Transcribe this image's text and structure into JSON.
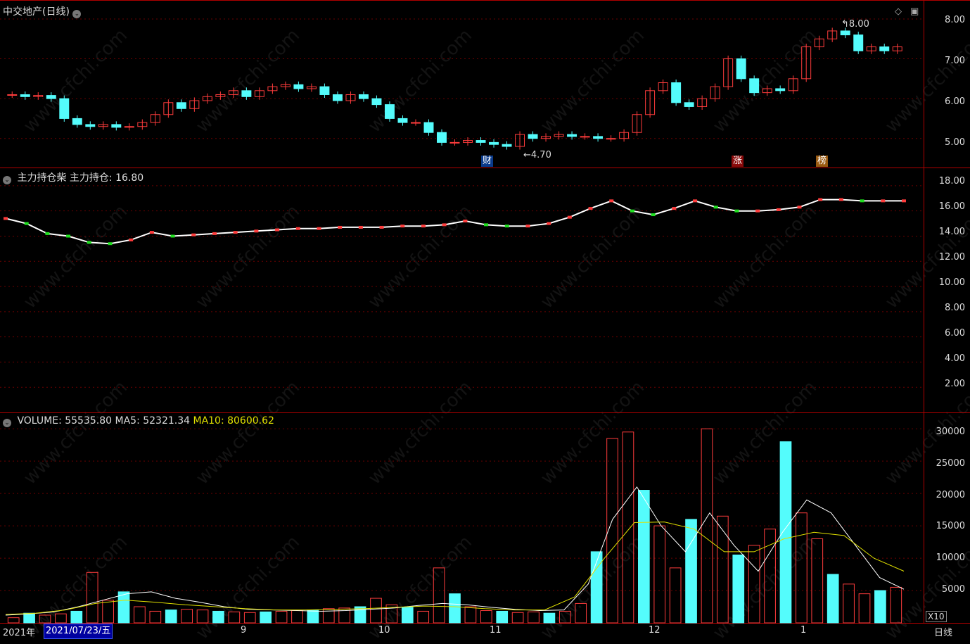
{
  "header": {
    "stock_title": "中交地产(日线)",
    "ma_label": "主力持仓柴",
    "ma_value_label": "主力持仓: 16.80",
    "volume_label": "VOLUME: 55535.80",
    "ma5_label": "MA5: 52321.34",
    "ma10_label": "MA10: 80600.62"
  },
  "price_axis": [
    "8.00",
    "7.00",
    "6.00",
    "5.00"
  ],
  "indicator_axis": [
    "18.00",
    "16.00",
    "14.00",
    "12.00",
    "10.00",
    "8.00",
    "6.00",
    "4.00",
    "2.00"
  ],
  "volume_axis": [
    "30000",
    "25000",
    "20000",
    "15000",
    "10000",
    "5000"
  ],
  "volume_unit": "X10",
  "x_axis": {
    "year_label": "2021年",
    "current_date": "2021/07/23/五",
    "ticks": [
      "9",
      "10",
      "11",
      "12",
      "1"
    ],
    "period": "日线"
  },
  "annotations": {
    "high": "8.00",
    "low": "4.70",
    "marker_cai": "财",
    "marker_zhang": "涨",
    "marker_bang": "榜"
  },
  "watermark": "www.cfchi.com",
  "colors": {
    "up": "#ff3c3c",
    "down": "#54fcfc",
    "axis": "#b00000",
    "ma5": "#ffffff",
    "ma10": "#e0e000"
  },
  "chart_data": {
    "type": "candlestick",
    "close_prices": [
      6.1,
      6.05,
      6.08,
      6.0,
      5.5,
      5.35,
      5.3,
      5.35,
      5.28,
      5.3,
      5.4,
      5.6,
      5.9,
      5.75,
      5.95,
      6.05,
      6.1,
      6.2,
      6.05,
      6.2,
      6.3,
      6.35,
      6.25,
      6.3,
      6.1,
      5.95,
      6.1,
      6.0,
      5.85,
      5.5,
      5.4,
      5.4,
      5.15,
      4.9,
      4.9,
      4.95,
      4.9,
      4.85,
      4.8,
      5.1,
      5.0,
      5.05,
      5.1,
      5.05,
      5.05,
      5.0,
      5.0,
      5.15,
      5.6,
      6.2,
      6.4,
      5.9,
      5.8,
      6.0,
      6.3,
      7.0,
      6.5,
      6.15,
      6.25,
      6.2,
      6.5,
      7.3,
      7.5,
      7.7,
      7.6,
      7.2,
      7.3,
      7.2,
      7.3
    ],
    "indicator_values": [
      15.4,
      15.0,
      14.2,
      14.0,
      13.5,
      13.4,
      13.7,
      14.3,
      14.0,
      14.1,
      14.2,
      14.3,
      14.4,
      14.5,
      14.6,
      14.6,
      14.7,
      14.7,
      14.7,
      14.8,
      14.8,
      14.9,
      15.2,
      14.9,
      14.8,
      14.8,
      15.0,
      15.5,
      16.2,
      16.8,
      16.0,
      15.7,
      16.2,
      16.8,
      16.3,
      16.0,
      16.0,
      16.1,
      16.3,
      16.9,
      16.9,
      16.8,
      16.8,
      16.8
    ],
    "volume_values": [
      800,
      1500,
      1200,
      1400,
      1800,
      7800,
      3500,
      4800,
      2500,
      1800,
      2000,
      2100,
      2000,
      1800,
      1700,
      1600,
      1700,
      1800,
      1900,
      2000,
      2200,
      2300,
      2500,
      3800,
      2800,
      2400,
      1800,
      8500,
      4500,
      2500,
      1900,
      1800,
      1600,
      1700,
      1500,
      1800,
      3000,
      11000,
      28500,
      29500,
      20500,
      15000,
      8500,
      16000,
      30000,
      16500,
      10500,
      12000,
      14500,
      28000,
      17000,
      13000,
      7500,
      6000,
      4500,
      5000,
      5500
    ],
    "ma5": [
      1200,
      1400,
      1700,
      2500,
      3500,
      4500,
      4800,
      3800,
      3200,
      2500,
      2100,
      2000,
      1900,
      1800,
      1900,
      2100,
      2300,
      2700,
      3000,
      2800,
      2400,
      2100,
      1900,
      2000,
      6000,
      16000,
      21000,
      15000,
      11000,
      17000,
      12000,
      8000,
      14000,
      19000,
      17000,
      12000,
      7000,
      5200
    ],
    "ma10": [
      1300,
      1500,
      2000,
      3000,
      3500,
      3200,
      2800,
      2500,
      2200,
      2000,
      2000,
      2100,
      2200,
      2400,
      2600,
      2500,
      2200,
      2000,
      2000,
      4000,
      10000,
      15500,
      15600,
      14500,
      11000,
      11000,
      13000,
      14000,
      13500,
      10000,
      8000
    ],
    "ylim_price": [
      4.5,
      8.3
    ],
    "ylim_indicator": [
      0,
      19
    ],
    "ylim_volume": [
      0,
      31000
    ]
  }
}
